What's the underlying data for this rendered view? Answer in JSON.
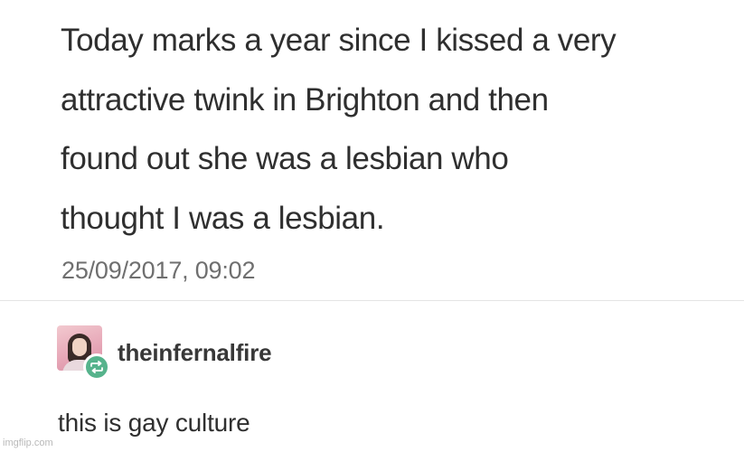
{
  "post": {
    "lines": [
      "Today marks a year since I kissed a very",
      "attractive twink in Brighton and then",
      "found out she was a lesbian who",
      "thought I was a lesbian."
    ],
    "timestamp": "25/09/2017, 09:02"
  },
  "reblog": {
    "avatar_icon": "user-avatar-icon",
    "badge_icon": "reblog-icon",
    "badge_color": "#56b38c",
    "username": "theinfernalfire",
    "comment": "this is gay culture"
  },
  "watermark": "imgflip.com"
}
